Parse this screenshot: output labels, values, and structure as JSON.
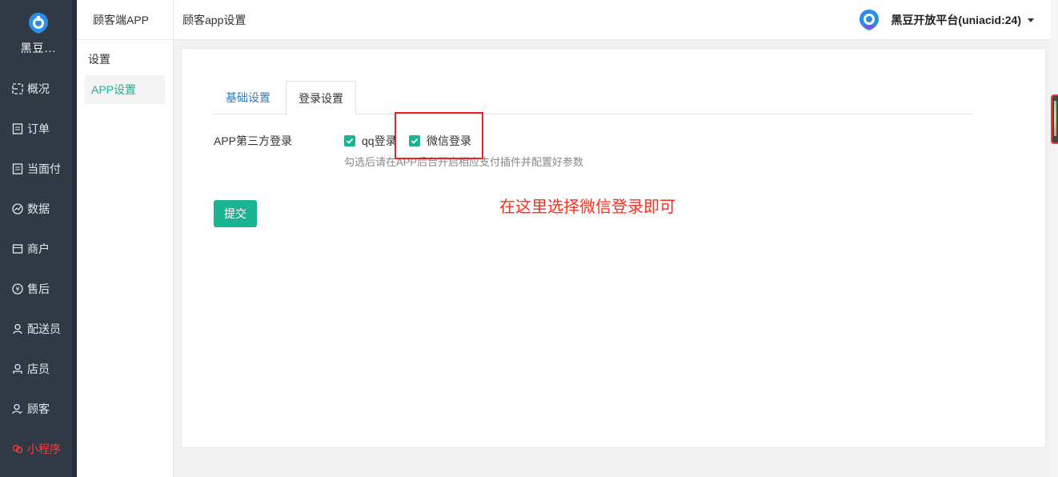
{
  "sidebar": {
    "brand_name": "黑豆...",
    "items": [
      {
        "label": "概况",
        "icon": "dashboard-icon"
      },
      {
        "label": "订单",
        "icon": "order-icon"
      },
      {
        "label": "当面付",
        "icon": "payment-icon"
      },
      {
        "label": "数据",
        "icon": "chart-icon"
      },
      {
        "label": "商户",
        "icon": "store-icon"
      },
      {
        "label": "售后",
        "icon": "aftersale-icon"
      },
      {
        "label": "配送员",
        "icon": "courier-icon"
      },
      {
        "label": "店员",
        "icon": "staff-icon"
      },
      {
        "label": "顾客",
        "icon": "customer-icon"
      },
      {
        "label": "小程序",
        "icon": "miniprogram-icon",
        "active": true
      }
    ]
  },
  "subnav": {
    "title": "顾客端APP",
    "group": "设置",
    "item": "APP设置"
  },
  "header": {
    "page_title": "顾客app设置",
    "account": "黑豆开放平台(uniacid:24)"
  },
  "tabs": [
    {
      "label": "基础设置"
    },
    {
      "label": "登录设置",
      "active": true
    }
  ],
  "form": {
    "label": "APP第三方登录",
    "options": [
      {
        "label": "qq登录",
        "checked": true
      },
      {
        "label": "微信登录",
        "checked": true
      }
    ],
    "hint": "勾选后请在APP后台开启相应支付插件并配置好参数",
    "submit": "提交"
  },
  "annotation": "在这里选择微信登录即可",
  "colors": {
    "sidebar_bg": "#2f3a45",
    "accent": "#1ab394",
    "annotation": "#ff2b1c",
    "active_nav": "#ff3b3b"
  }
}
